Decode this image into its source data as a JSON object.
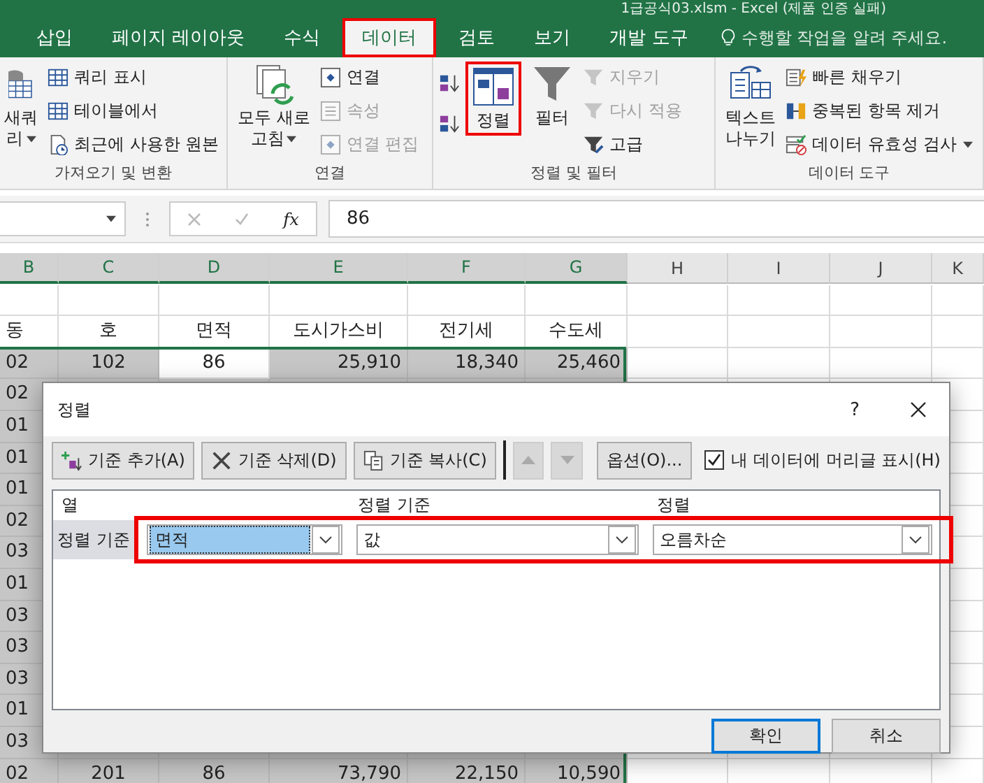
{
  "title": "1급공식03.xlsm - Excel (제품 인증 실패)",
  "tabs": [
    {
      "label": "삽입",
      "selected": false
    },
    {
      "label": "페이지 레이아웃",
      "selected": false
    },
    {
      "label": "수식",
      "selected": false
    },
    {
      "label": "데이터",
      "selected": true
    },
    {
      "label": "검토",
      "selected": false
    },
    {
      "label": "보기",
      "selected": false
    },
    {
      "label": "개발 도구",
      "selected": false
    }
  ],
  "tell_me": {
    "placeholder": "수행할 작업을 알려 주세요."
  },
  "ribbon": [
    {
      "label": "가져오기 및 변환",
      "items": [
        {
          "kind": "large",
          "lines": [
            "새쿼",
            "리"
          ],
          "dropdown": true,
          "highlighted": false
        },
        {
          "kind": "stack",
          "entries": [
            {
              "label": "쿼리 표시",
              "disabled": false,
              "dropdown": false
            },
            {
              "label": "테이블에서",
              "disabled": false,
              "dropdown": false
            },
            {
              "label": "최근에 사용한 원본",
              "disabled": false,
              "dropdown": false
            }
          ]
        }
      ]
    },
    {
      "label": "연결",
      "items": [
        {
          "kind": "large",
          "lines": [
            "모두 새로",
            "고침"
          ],
          "dropdown": true,
          "highlighted": false
        },
        {
          "kind": "stack",
          "entries": [
            {
              "label": "연결",
              "disabled": false,
              "dropdown": false
            },
            {
              "label": "속성",
              "disabled": true,
              "dropdown": false
            },
            {
              "label": "연결 편집",
              "disabled": true,
              "dropdown": false
            }
          ]
        }
      ]
    },
    {
      "label": "정렬 및 필터",
      "items": [
        {
          "kind": "sort_pair"
        },
        {
          "kind": "large",
          "lines": [
            "정렬"
          ],
          "dropdown": false,
          "highlighted": true
        },
        {
          "kind": "large",
          "lines": [
            "필터"
          ],
          "dropdown": false,
          "highlighted": false
        },
        {
          "kind": "stack",
          "entries": [
            {
              "label": "지우기",
              "disabled": true,
              "dropdown": false
            },
            {
              "label": "다시 적용",
              "disabled": true,
              "dropdown": false
            },
            {
              "label": "고급",
              "disabled": false,
              "dropdown": false
            }
          ]
        }
      ]
    },
    {
      "label": "데이터 도구",
      "items": [
        {
          "kind": "large",
          "lines": [
            "텍스트",
            "나누기"
          ],
          "dropdown": false,
          "highlighted": false
        },
        {
          "kind": "stack",
          "entries": [
            {
              "label": "빠른 채우기",
              "disabled": false,
              "dropdown": false
            },
            {
              "label": "중복된 항목 제거",
              "disabled": false,
              "dropdown": false
            },
            {
              "label": "데이터 유효성 검사",
              "disabled": false,
              "dropdown": true
            }
          ]
        }
      ]
    }
  ],
  "formula_bar": {
    "function_label": "fx",
    "value": "86"
  },
  "grid": {
    "columns": [
      {
        "label": "B",
        "selected": true
      },
      {
        "label": "C",
        "selected": true
      },
      {
        "label": "D",
        "selected": true
      },
      {
        "label": "E",
        "selected": true
      },
      {
        "label": "F",
        "selected": true
      },
      {
        "label": "G",
        "selected": true
      },
      {
        "label": "H",
        "selected": false
      },
      {
        "label": "I",
        "selected": false
      },
      {
        "label": "J",
        "selected": false
      },
      {
        "label": "K",
        "selected": false
      }
    ],
    "rows": [
      {
        "selected": false
      },
      {
        "selected": false,
        "cells": [
          {
            "text": "동"
          },
          {
            "text": "호"
          },
          {
            "text": "면적"
          },
          {
            "text": "도시가스비"
          },
          {
            "text": "전기세"
          },
          {
            "text": "수도세"
          }
        ]
      },
      {
        "selected": true,
        "cells": [
          {
            "text": "02",
            "active": false
          },
          {
            "text": "102",
            "active": false
          },
          {
            "text": "86",
            "active": true
          },
          {
            "text": "25,910",
            "active": false
          },
          {
            "text": "18,340",
            "active": false
          },
          {
            "text": "25,460",
            "active": false
          }
        ]
      },
      {
        "selected": true,
        "cells": [
          {
            "text": "02",
            "active": false
          }
        ]
      },
      {
        "selected": true,
        "cells": [
          {
            "text": "01",
            "active": false
          }
        ]
      },
      {
        "selected": true,
        "cells": [
          {
            "text": "01",
            "active": false
          }
        ]
      },
      {
        "selected": true,
        "cells": [
          {
            "text": "01",
            "active": false
          }
        ]
      },
      {
        "selected": true,
        "cells": [
          {
            "text": "02",
            "active": false
          }
        ]
      },
      {
        "selected": true,
        "cells": [
          {
            "text": "03",
            "active": false
          }
        ]
      },
      {
        "selected": true,
        "cells": [
          {
            "text": "01",
            "active": false
          }
        ]
      },
      {
        "selected": true,
        "cells": [
          {
            "text": "03",
            "active": false
          }
        ]
      },
      {
        "selected": true,
        "cells": [
          {
            "text": "03",
            "active": false
          }
        ]
      },
      {
        "selected": true,
        "cells": [
          {
            "text": "03",
            "active": false
          }
        ]
      },
      {
        "selected": true,
        "cells": [
          {
            "text": "01",
            "active": false
          }
        ]
      },
      {
        "selected": true,
        "cells": [
          {
            "text": "03",
            "active": false
          }
        ]
      },
      {
        "selected": true,
        "cells": [
          {
            "text": "02",
            "active": false
          },
          {
            "text": "201",
            "active": false
          },
          {
            "text": "86",
            "active": false
          },
          {
            "text": "73,790",
            "active": false
          },
          {
            "text": "22,150",
            "active": false
          },
          {
            "text": "10,590",
            "active": false
          }
        ]
      }
    ]
  },
  "dialog": {
    "title": "정렬",
    "help_label": "?",
    "toolbar": [
      {
        "kind": "add",
        "label": "기준 추가(A)",
        "disabled": false
      },
      {
        "kind": "delete",
        "label": "기준 삭제(D)",
        "disabled": false
      },
      {
        "kind": "copy",
        "label": "기준 복사(C)",
        "disabled": false
      },
      {
        "kind": "up",
        "disabled": true
      },
      {
        "kind": "down",
        "disabled": true
      },
      {
        "kind": "text",
        "label": "옵션(O)...",
        "disabled": false
      }
    ],
    "header_checkbox": {
      "label": "내 데이터에 머리글 표시(H)",
      "checked": true
    },
    "columns": [
      "열",
      "정렬 기준",
      "정렬"
    ],
    "levels": [
      {
        "label": "정렬 기준",
        "selected": true,
        "highlighted": true,
        "column": {
          "value": "면적",
          "selected": true
        },
        "sort_on": {
          "value": "값"
        },
        "order": {
          "value": "오름차순"
        }
      }
    ],
    "buttons": [
      {
        "label": "확인",
        "default": true
      },
      {
        "label": "취소",
        "default": false
      }
    ]
  }
}
